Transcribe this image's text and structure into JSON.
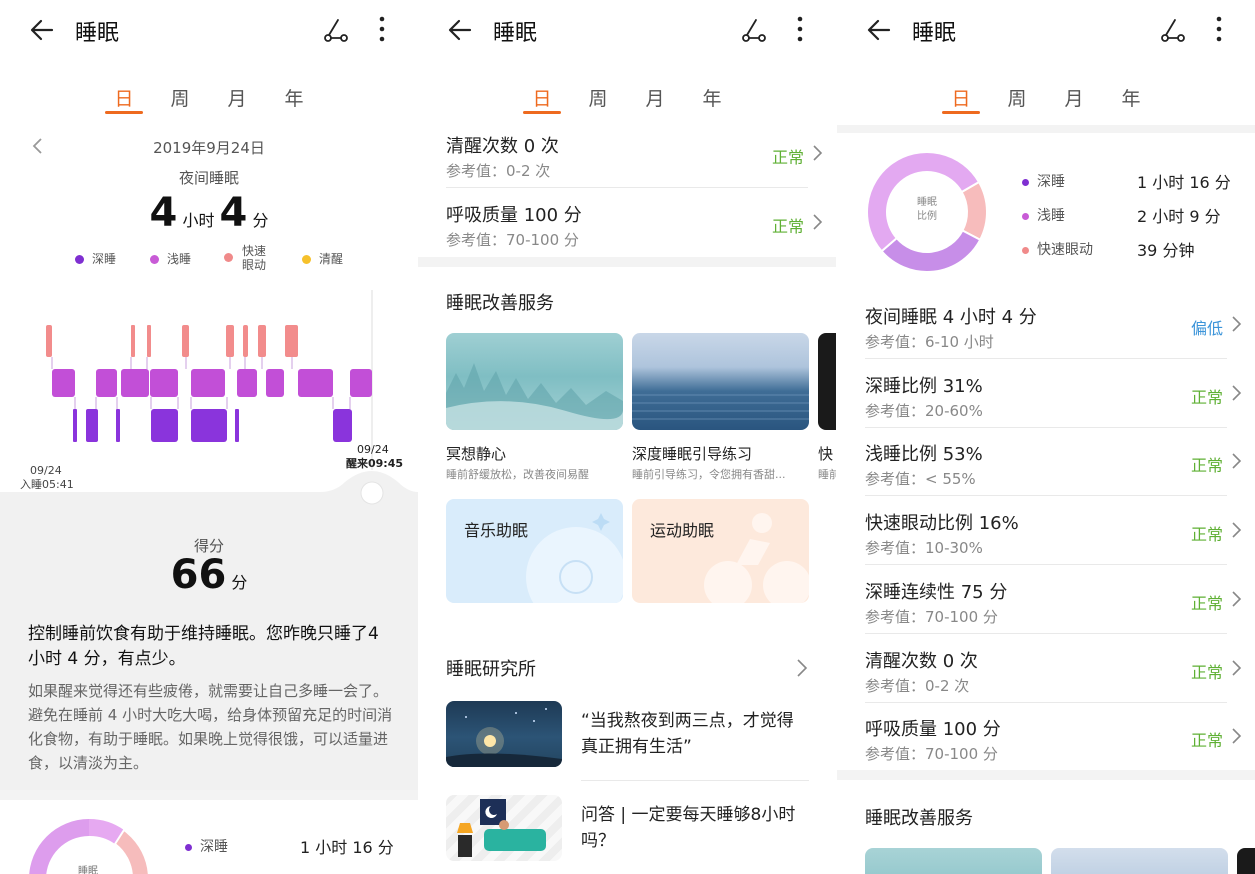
{
  "screens": {
    "p1": {
      "title": "睡眠",
      "tabs": [
        "日",
        "周",
        "月",
        "年"
      ],
      "date": "2019年9月24日",
      "label": "夜间睡眠",
      "hours": "4",
      "hours_unit": "小时",
      "minutes": "4",
      "minutes_unit": "分",
      "legend": [
        {
          "name": "深睡",
          "color": "#7f2fd1"
        },
        {
          "name": "浅睡",
          "color": "#c85bd6"
        },
        {
          "name": "快速\n眼动",
          "color": "#f08a8a"
        },
        {
          "name": "清醒",
          "color": "#f6c12b"
        }
      ],
      "start_date": "09/24",
      "start_label": "入睡05:41",
      "end_date": "09/24",
      "end_label": "醒来09:45",
      "score_label": "得分",
      "score": "66",
      "score_unit": "分",
      "advice_title": "控制睡前饮食有助于维持睡眠。您昨晚只睡了4 小时 4 分，有点少。",
      "advice_body": "如果醒来觉得还有些疲倦，就需要让自己多睡一会了。避免在睡前 4 小时大吃大喝，给身体预留充足的时间消化食物，有助于睡眠。如果晚上觉得很饿，可以适量进食，以清淡为主。",
      "pie_center": "睡眠",
      "pie_item1_name": "深睡",
      "pie_item1_value": "1 小时 16 分"
    },
    "p2": {
      "title": "睡眠",
      "tabs": [
        "日",
        "周",
        "月",
        "年"
      ],
      "rows": [
        {
          "title": "清醒次数  0 次",
          "ref": "参考值：0-2 次",
          "status": "正常"
        },
        {
          "title": "呼吸质量  100 分",
          "ref": "参考值：70-100 分",
          "status": "正常"
        }
      ],
      "service_title": "睡眠改善服务",
      "services": [
        {
          "title": "冥想静心",
          "sub": "睡前舒缓放松，改善夜间易醒"
        },
        {
          "title": "深度睡眠引导练习",
          "sub": "睡前引导练习，令您拥有香甜..."
        },
        {
          "title": "快",
          "sub": "睡前"
        }
      ],
      "music": "音乐助眠",
      "sport": "运动助眠",
      "lab_title": "睡眠研究所",
      "articles": [
        {
          "title": "“当我熬夜到两三点，才觉得真正拥有生活”"
        },
        {
          "title": "问答 | 一定要每天睡够8小时吗？"
        }
      ]
    },
    "p3": {
      "title": "睡眠",
      "tabs": [
        "日",
        "周",
        "月",
        "年"
      ],
      "pie_center": "睡眠\n比例",
      "pie": [
        {
          "name": "深睡",
          "value": "1 小时 16 分",
          "pct": 31,
          "color": "#c78ee8"
        },
        {
          "name": "浅睡",
          "value": "2 小时 9 分",
          "pct": 53,
          "color": "#e3a9f1"
        },
        {
          "name": "快速眼动",
          "value": "39 分钟",
          "pct": 16,
          "color": "#f7bcbc"
        }
      ],
      "rows": [
        {
          "title": "夜间睡眠  4 小时 4 分",
          "ref": "参考值：6-10 小时",
          "status": "偏低"
        },
        {
          "title": "深睡比例  31%",
          "ref": "参考值：20-60%",
          "status": "正常"
        },
        {
          "title": "浅睡比例  53%",
          "ref": "参考值：< 55%",
          "status": "正常"
        },
        {
          "title": "快速眼动比例  16%",
          "ref": "参考值：10-30%",
          "status": "正常"
        },
        {
          "title": "深睡连续性  75 分",
          "ref": "参考值：70-100 分",
          "status": "正常"
        },
        {
          "title": "清醒次数  0 次",
          "ref": "参考值：0-2 次",
          "status": "正常"
        },
        {
          "title": "呼吸质量  100 分",
          "ref": "参考值：70-100 分",
          "status": "正常"
        }
      ],
      "service_title": "睡眠改善服务"
    }
  },
  "colors": {
    "accent": "#ee6a1f",
    "normal": "#5fb034",
    "low": "#3b94d9"
  }
}
